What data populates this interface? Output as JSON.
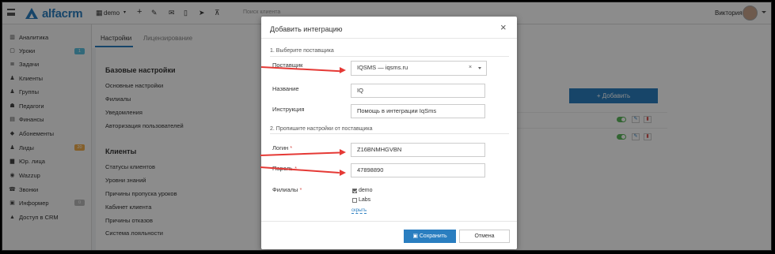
{
  "topbar": {
    "logo": "alfacrm",
    "branch": "demo",
    "plus": "+",
    "search_placeholder": "Поиск клиента",
    "user_name": "Виктория",
    "icons": [
      "menu-icon",
      "pen-icon",
      "mail-icon",
      "phone-icon",
      "send-icon",
      "cart-icon"
    ]
  },
  "sidebar": {
    "items": [
      {
        "label": "Аналитика",
        "icon": "▥"
      },
      {
        "label": "Уроки",
        "icon": "▢",
        "badge": "1",
        "badge_color": "#5bc0de"
      },
      {
        "label": "Задачи",
        "icon": "≣"
      },
      {
        "label": "Клиенты",
        "icon": "♟"
      },
      {
        "label": "Группы",
        "icon": "♟"
      },
      {
        "label": "Педагоги",
        "icon": "☗"
      },
      {
        "label": "Финансы",
        "icon": "▤"
      },
      {
        "label": "Абонементы",
        "icon": "◆"
      },
      {
        "label": "Лиды",
        "icon": "♟",
        "badge": "20",
        "badge_color": "#f0ad4e"
      },
      {
        "label": "Юр. лица",
        "icon": "▆"
      },
      {
        "label": "Wazzup",
        "icon": "◉"
      },
      {
        "label": "Звонки",
        "icon": "☎"
      },
      {
        "label": "Информер",
        "icon": "▣",
        "badge": "0",
        "badge_color": "#bbbbbb"
      },
      {
        "label": "Доступ в CRM",
        "icon": "▲"
      }
    ]
  },
  "tabs": {
    "settings": "Настройки",
    "license": "Лицензирование"
  },
  "basic": {
    "title": "Базовые настройки",
    "links": [
      "Основные настройки",
      "Филиалы",
      "Уведомления",
      "Авторизация пользователей"
    ]
  },
  "clients": {
    "title": "Клиенты",
    "links": [
      "Статусы клиентов",
      "Уровни знаний",
      "Причины пропуска уроков",
      "Кабинет клиента",
      "Причины отказов",
      "Система лояльности"
    ]
  },
  "add_button": "+ Добавить",
  "modal": {
    "title": "Добавить интеграцию",
    "close": "×",
    "step1": "1. Выберите поставщика",
    "step2": "2. Пропишите настройки от поставщика",
    "provider_label": "Поставщик",
    "provider_value": "IQSMS — iqsms.ru",
    "provider_clear": "×",
    "name_label": "Название",
    "name_value": "IQ",
    "instruction_label": "Инструкция",
    "instruction_value": "Помощь в интеграции IqSms",
    "login_label": "Логин",
    "login_value": "Z16BNMHGVBN",
    "password_label": "Пароль",
    "password_value": "47898890",
    "branches_label": "Филиалы",
    "required_mark": "*",
    "branches": [
      {
        "label": "demo",
        "checked": true
      },
      {
        "label": "Labs",
        "checked": false
      }
    ],
    "hide_link": "скрыть",
    "save": "Сохранить",
    "cancel": "Отмена"
  }
}
